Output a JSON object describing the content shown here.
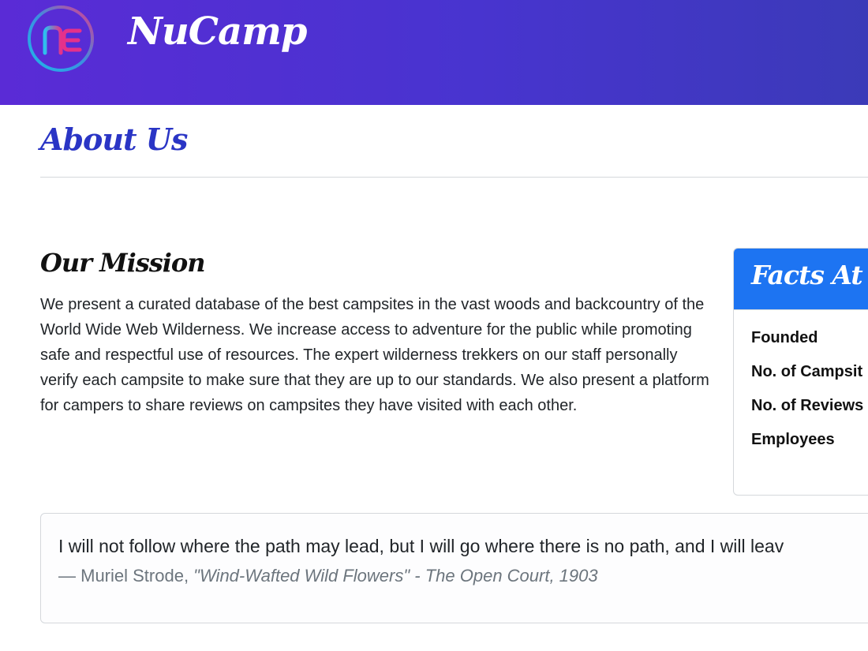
{
  "header": {
    "brand": "NuCamp",
    "logo_icon": "nucamp-logo-icon",
    "gradient_start": "#5a2bd6",
    "gradient_end": "#3b3ab8"
  },
  "page": {
    "title": "About Us"
  },
  "mission": {
    "heading": "Our Mission",
    "text": "We present a curated database of the best campsites in the vast woods and backcountry of the World Wide Web Wilderness. We increase access to adventure for the public while promoting safe and respectful use of resources. The expert wilderness trekkers on our staff personally verify each campsite to make sure that they are up to our standards. We also present a platform for campers to share reviews on campsites they have visited with each other."
  },
  "facts": {
    "heading": "Facts At a",
    "items": [
      "Founded",
      "No. of Campsit",
      "No. of Reviews",
      "Employees"
    ],
    "accent_color": "#1d74f2"
  },
  "quote": {
    "text": "I will not follow where the path may lead, but I will go where there is no path, and I will leav",
    "author": "— Muriel Strode, ",
    "source": "\"Wind-Wafted Wild Flowers\" - The Open Court, 1903"
  }
}
